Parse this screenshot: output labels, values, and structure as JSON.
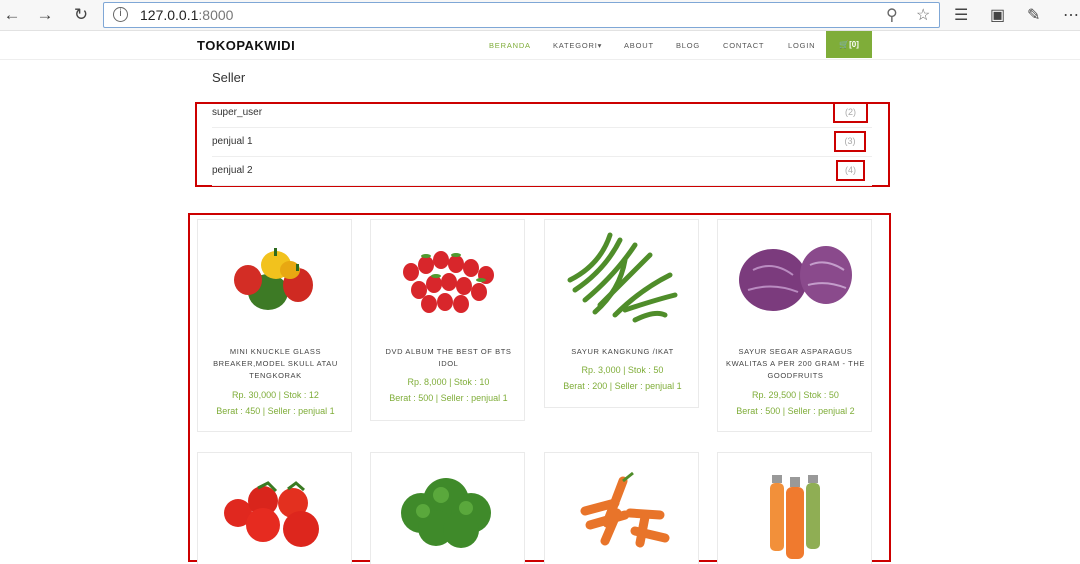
{
  "browser": {
    "url_host": "127.0.0.1",
    "url_port": ":8000",
    "back_icon": "arrow-left-icon",
    "forward_icon": "arrow-right-icon",
    "refresh_icon": "refresh-icon",
    "info_icon": "info-icon",
    "zoom_icon": "zoom-icon",
    "star_icon": "star-icon",
    "favorites_icon": "favorites-icon",
    "collections_icon": "collections-icon",
    "profile_icon": "profile-icon",
    "more_icon": "more-icon"
  },
  "header": {
    "logo": "TOKOPAKWIDI",
    "menu": {
      "beranda": "BERANDA",
      "kategori": "KATEGORI",
      "about": "ABOUT",
      "blog": "BLOG",
      "contact": "CONTACT",
      "login": "LOGIN"
    },
    "cart_label": "[0]",
    "accent_color": "#7fad39"
  },
  "sellers": {
    "title": "Seller",
    "items": [
      {
        "name": "super_user",
        "count": "(2)"
      },
      {
        "name": "penjual 1",
        "count": "(3)"
      },
      {
        "name": "penjual 2",
        "count": "(4)"
      }
    ]
  },
  "products": [
    {
      "name": "MINI KNUCKLE GLASS BREAKER,MODEL SKULL ATAU TENGKORAK",
      "price": "Rp. 30,000 | Stok : 12",
      "detail": "Berat : 450 | Seller : penjual 1",
      "image": "bell-peppers-image"
    },
    {
      "name": "DVD ALBUM THE BEST OF BTS IDOL",
      "price": "Rp. 8,000 | Stok : 10",
      "detail": "Berat : 500 | Seller : penjual 1",
      "image": "strawberries-image"
    },
    {
      "name": "SAYUR KANGKUNG /IKAT",
      "price": "Rp. 3,000 | Stok : 50",
      "detail": "Berat : 200 | Seller : penjual 1",
      "image": "green-beans-image"
    },
    {
      "name": "SAYUR SEGAR ASPARAGUS KWALITAS A PER 200 GRAM - THE GOODFRUITS",
      "price": "Rp. 29,500 | Stok : 50",
      "detail": "Berat : 500 | Seller : penjual 2",
      "image": "red-cabbage-image"
    },
    {
      "name": "",
      "price": "",
      "detail": "",
      "image": "tomatoes-image"
    },
    {
      "name": "",
      "price": "",
      "detail": "",
      "image": "broccoli-image"
    },
    {
      "name": "",
      "price": "",
      "detail": "",
      "image": "carrots-image"
    },
    {
      "name": "",
      "price": "",
      "detail": "",
      "image": "juice-bottles-image"
    }
  ]
}
